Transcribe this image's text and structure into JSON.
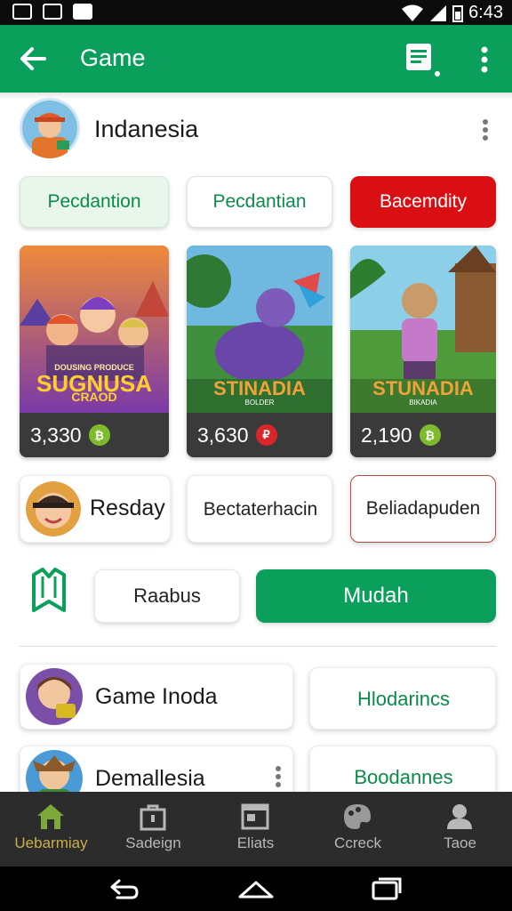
{
  "status_bar": {
    "time": "6:43"
  },
  "app_bar": {
    "title": "Game"
  },
  "profile": {
    "name": "Indanesia"
  },
  "filters": [
    {
      "label": "Pecdantion"
    },
    {
      "label": "Pecdantian"
    },
    {
      "label": "Bacemdity"
    }
  ],
  "games": [
    {
      "art_title": "SUGNUSA",
      "art_sub": "CRAOD",
      "art_top": "DOUSING PRODUCE",
      "count": "3,330",
      "coin_color": "#7dbb2d"
    },
    {
      "art_title": "STINADIA",
      "art_sub": "BOLDER",
      "count": "3,630",
      "coin_color": "#d8262b"
    },
    {
      "art_title": "STUNADIA",
      "art_sub": "BIKADIA",
      "count": "2,190",
      "coin_color": "#7dbb2d"
    }
  ],
  "row1": {
    "name": "Resday",
    "option_a": "Bectaterhacin",
    "option_b": "Beliadapuden"
  },
  "actions": {
    "secondary": "Raabus",
    "primary": "Mudah"
  },
  "list": [
    {
      "name": "Game Inoda",
      "action": "Hlodarincs"
    },
    {
      "name": "Demallesia",
      "action": "Boodannes"
    }
  ],
  "bottom_nav": [
    {
      "label": "Uebarmiay",
      "icon": "home-icon"
    },
    {
      "label": "Sadeign",
      "icon": "bag-icon"
    },
    {
      "label": "Eliats",
      "icon": "window-icon"
    },
    {
      "label": "Ccreck",
      "icon": "palette-icon"
    },
    {
      "label": "Taoe",
      "icon": "person-icon"
    }
  ],
  "colors": {
    "primary": "#0aa05c",
    "accent_red": "#d90f14",
    "nav_bg": "#2c2c2c"
  }
}
